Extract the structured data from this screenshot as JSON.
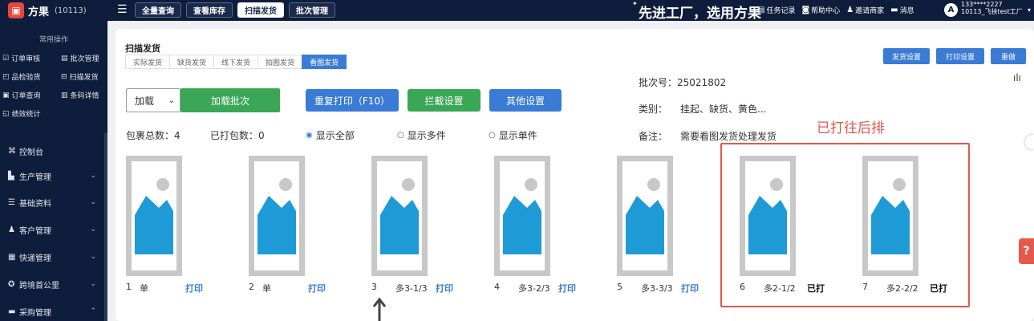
{
  "topbar": {
    "brand": "方果",
    "brand_code": "(10113)",
    "menu_icon": "menu-icon",
    "tabs": [
      {
        "label": "全量查询"
      },
      {
        "label": "查看库存"
      },
      {
        "label": "扫描发货"
      },
      {
        "label": "批次管理"
      }
    ],
    "active_tab": "扫描发货",
    "slogan": "先进工厂，选用方果",
    "links": [
      {
        "icon": "task-icon",
        "label": "任务记录"
      },
      {
        "icon": "help-icon",
        "label": "帮助中心"
      },
      {
        "icon": "invite-icon",
        "label": "邀请商家"
      },
      {
        "icon": "message-icon",
        "label": "消息"
      }
    ],
    "avatar": "A",
    "user_phone": "133****2227",
    "user_name": "10113_飞扶test工厂"
  },
  "sidebar": {
    "common_title": "常用操作",
    "quick": [
      {
        "icon": "☑",
        "label": "订单审核"
      },
      {
        "icon": "▤",
        "label": "批次管理"
      },
      {
        "icon": "◰",
        "label": "品检验货"
      },
      {
        "icon": "⊟",
        "label": "扫描发货"
      },
      {
        "icon": "▣",
        "label": "订单查询"
      },
      {
        "icon": "▥",
        "label": "条码详情"
      },
      {
        "icon": "◱",
        "label": "绩效统计"
      }
    ],
    "items": [
      {
        "icon": "⌘",
        "label": "控制台",
        "chev": ""
      },
      {
        "icon": "▙",
        "label": "生产管理",
        "chev": "⌄"
      },
      {
        "icon": "☰",
        "label": "基础资料",
        "chev": "⌄"
      },
      {
        "icon": "♟",
        "label": "客户管理",
        "chev": "⌄"
      },
      {
        "icon": "▦",
        "label": "快递管理",
        "chev": "⌄"
      },
      {
        "icon": "✪",
        "label": "跨境首公里",
        "chev": "⌄"
      },
      {
        "icon": "▬",
        "label": "采购管理",
        "chev": "⌃"
      }
    ]
  },
  "main": {
    "title": "扫描发货",
    "sub_tabs": [
      {
        "label": "实际发货"
      },
      {
        "label": "缺货发货"
      },
      {
        "label": "线下发货"
      },
      {
        "label": "拍图发货"
      },
      {
        "label": "看图发货"
      }
    ],
    "active_sub_tab": "看图发货",
    "right_buttons": [
      {
        "label": "发货设置"
      },
      {
        "label": "打印设置"
      },
      {
        "label": "重做"
      }
    ],
    "load_select": {
      "value": "加载"
    },
    "load_batch_button": "加载批次",
    "reprint_button": "重复打印（F10）",
    "intercept_button": "拦截设置",
    "other_button": "其他设置",
    "batch_no_label": "批次号：",
    "batch_no": "25021802",
    "category_label": "类别：",
    "category": "挂起、缺货、黄色...",
    "remark_label": "备注：",
    "remark": "需要看图发货处理发货",
    "total_label": "包裹总数：",
    "total": "4",
    "printed_label": "已打包数：",
    "printed": "0",
    "filters": [
      {
        "label": "显示全部",
        "selected": true
      },
      {
        "label": "显示多件",
        "selected": false
      },
      {
        "label": "显示单件",
        "selected": false
      }
    ],
    "annotation_note": "已打往后排",
    "items": [
      {
        "index": "1",
        "label": "单",
        "action": "打印",
        "state": "print"
      },
      {
        "index": "2",
        "label": "单",
        "action": "打印",
        "state": "print"
      },
      {
        "index": "3",
        "label": "多3-1/3",
        "action": "打印",
        "state": "print"
      },
      {
        "index": "4",
        "label": "多3-2/3",
        "action": "打印",
        "state": "print"
      },
      {
        "index": "5",
        "label": "多3-3/3",
        "action": "打印",
        "state": "print"
      },
      {
        "index": "6",
        "label": "多2-1/2",
        "action": "已打",
        "state": "done"
      },
      {
        "index": "7",
        "label": "多2-2/2",
        "action": "已打",
        "state": "done"
      }
    ]
  },
  "colors": {
    "nav_bg": "#0f1d3c",
    "primary": "#3a7bd5",
    "success": "#3aa757",
    "annotation": "#e5584b",
    "image_blue": "#1e9bd7"
  }
}
